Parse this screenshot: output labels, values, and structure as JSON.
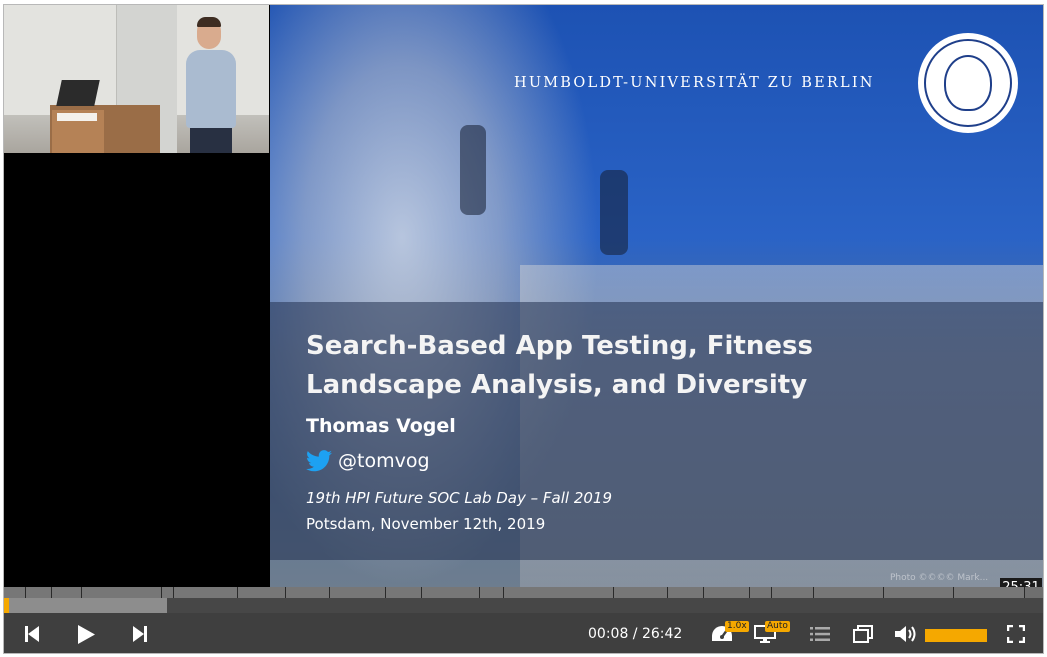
{
  "slide": {
    "university": "HUMBOLDT-UNIVERSITÄT ZU BERLIN",
    "title_line1": "Search-Based App Testing, Fitness",
    "title_line2": "Landscape Analysis, and Diversity",
    "author": "Thomas Vogel",
    "twitter_handle": "@tomvog",
    "event": "19th HPI Future SOC Lab Day – Fall 2019",
    "place_date": "Potsdam, November 12th, 2019",
    "credit": "Photo ©©©© Mark..."
  },
  "seek_tooltip": "25:31",
  "player": {
    "current_time": "00:08",
    "duration": "26:42",
    "time_separator": " / ",
    "playback_speed": "1.0x",
    "quality": "Auto",
    "progress_fraction": 0.005,
    "buffered_fraction": 0.157,
    "volume_fraction": 1.0
  },
  "colors": {
    "accent": "#f5a800",
    "control_bar": "#3f3f3f",
    "slide_blue": "#2a63c6",
    "twitter_blue": "#1da1f2"
  },
  "icons": {
    "previous": "skip-previous-icon",
    "play": "play-icon",
    "next": "skip-next-icon",
    "speed": "speedometer-icon",
    "quality": "monitor-icon",
    "chapters": "list-icon",
    "layout": "picture-in-picture-icon",
    "volume": "volume-icon",
    "fullscreen": "fullscreen-icon"
  }
}
